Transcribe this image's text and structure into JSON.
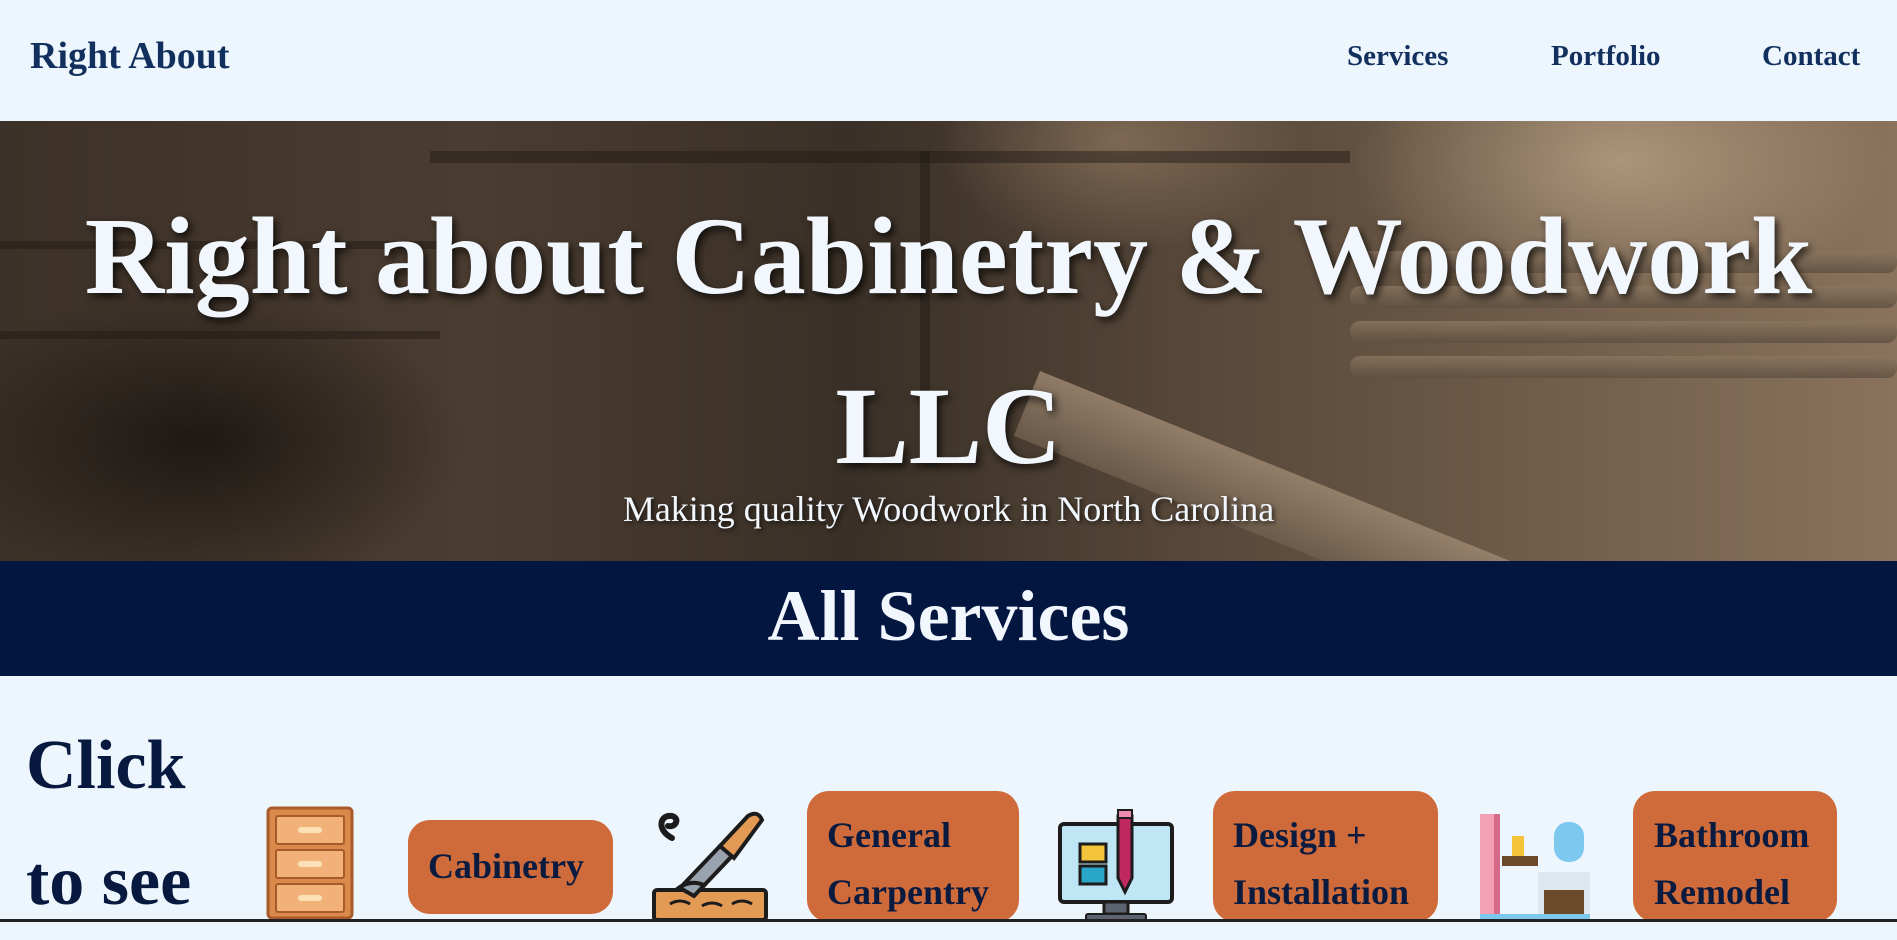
{
  "nav": {
    "brand": "Right About",
    "links": [
      "Services",
      "Portfolio",
      "Contact"
    ]
  },
  "hero": {
    "title": "Right about Cabinetry & Woodwork LLC",
    "subtitle": "Making quality Woodwork in North Carolina"
  },
  "banner": {
    "title": "All Services"
  },
  "services": {
    "prompt": "Click to see",
    "items": [
      {
        "label": "Cabinetry",
        "icon": "dresser-icon"
      },
      {
        "label": "General Carpentry",
        "icon": "chisel-wood-icon"
      },
      {
        "label": "Design + Installation",
        "icon": "computer-design-icon"
      },
      {
        "label": "Bathroom Remodel",
        "icon": "bathroom-icon"
      }
    ]
  },
  "colors": {
    "page_bg": "#eef6fd",
    "nav_text": "#12305e",
    "banner_bg": "#021640",
    "button_bg": "#cf6b3a",
    "button_text": "#0b1b3f"
  }
}
